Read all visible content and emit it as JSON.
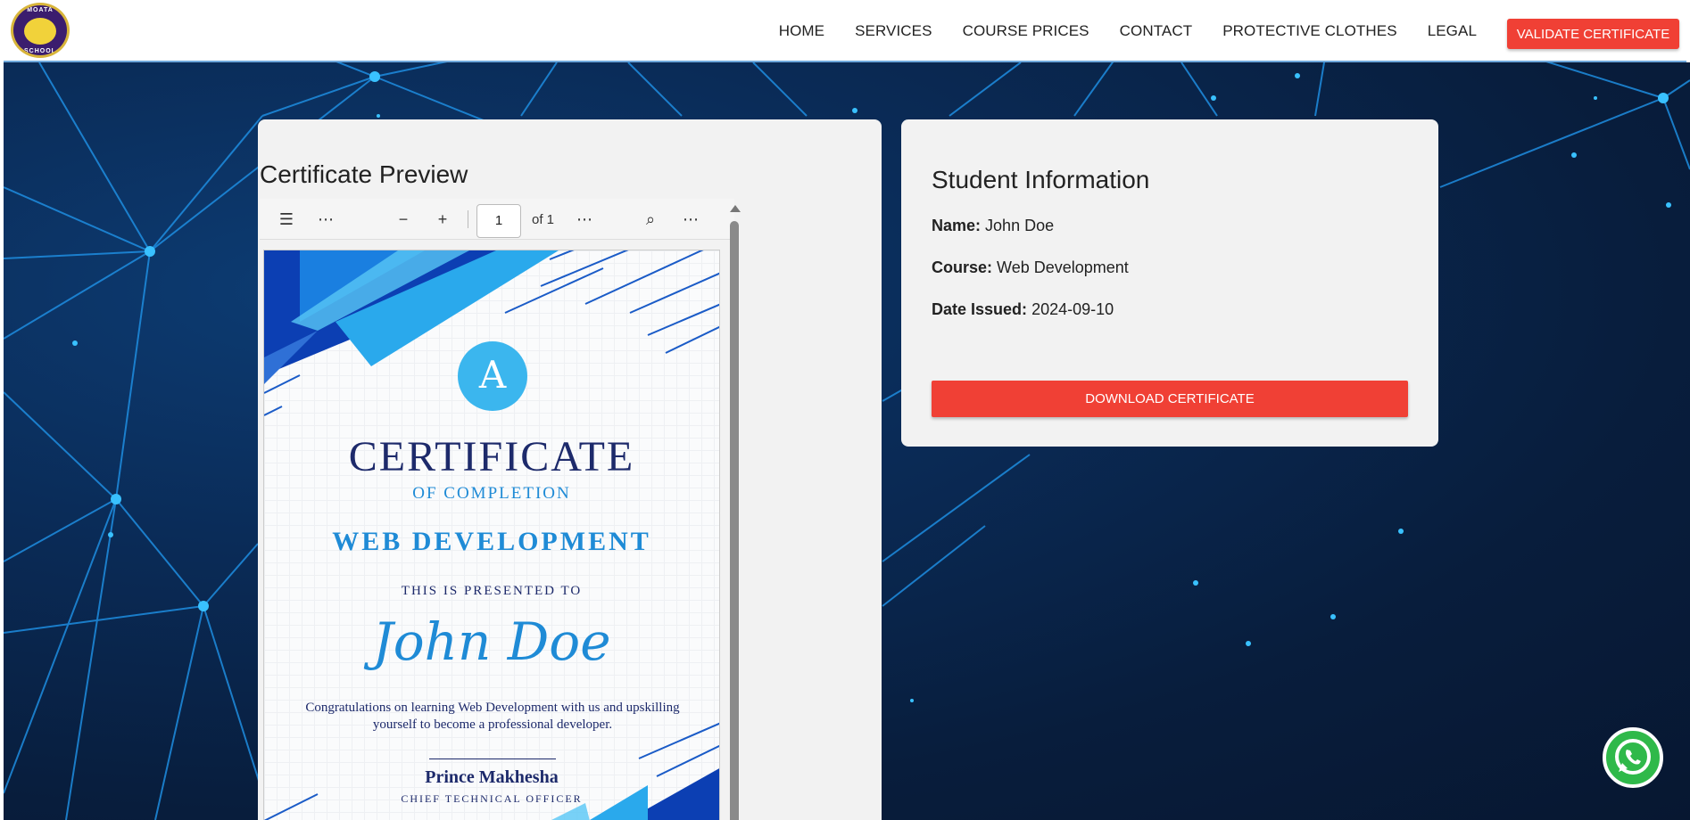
{
  "header": {
    "logo": {
      "top_text": "MOATA",
      "bottom_text": "SCHOOL"
    },
    "nav": [
      "HOME",
      "SERVICES",
      "COURSE PRICES",
      "CONTACT",
      "PROTECTIVE CLOTHES",
      "LEGAL"
    ],
    "validate_label": "VALIDATE CERTIFICATE"
  },
  "preview": {
    "title": "Certificate Preview",
    "toolbar": {
      "page_value": "1",
      "page_of": "of 1"
    },
    "certificate": {
      "logo_mark": "A",
      "title": "CERTIFICATE",
      "subtitle": "OF COMPLETION",
      "course": "WEB DEVELOPMENT",
      "presented": "THIS IS PRESENTED TO",
      "name": "John Doe",
      "message": "Congratulations on learning Web Development with us and upskilling yourself to become a professional developer.",
      "signer": "Prince Makhesha",
      "role": "CHIEF TECHNICAL OFFICER"
    }
  },
  "info": {
    "title": "Student Information",
    "name_label": "Name:",
    "name_value": "John Doe",
    "course_label": "Course:",
    "course_value": "Web Development",
    "date_label": "Date Issued:",
    "date_value": "2024-09-10",
    "download_label": "DOWNLOAD CERTIFICATE"
  },
  "colors": {
    "accent": "#f04035",
    "certificate_blue": "#1f8bd6",
    "certificate_navy": "#1d2a6b",
    "whatsapp": "#2fb94a"
  }
}
